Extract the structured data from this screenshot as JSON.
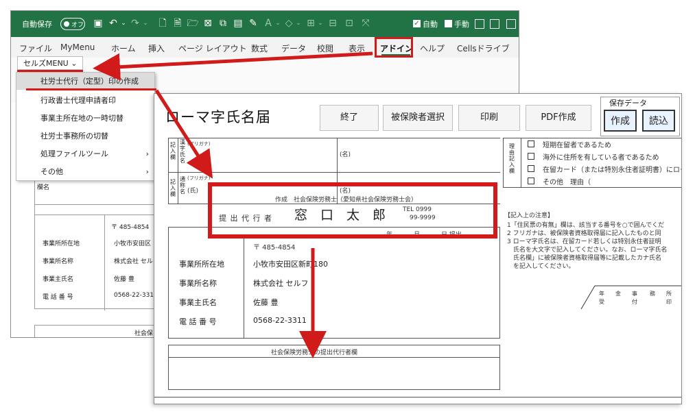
{
  "excel": {
    "titlebar": {
      "autosave_label": "自動保存",
      "autosave_state": "オフ",
      "auto_label": "自動",
      "manual_label": "手動"
    },
    "menu": [
      "ファイル",
      "MyMenu",
      "ホーム",
      "挿入",
      "ページ レイアウト",
      "数式",
      "データ",
      "校閲",
      "表示",
      "アドイン",
      "ヘルプ",
      "Cellsドライブ"
    ],
    "ribbon_button": "セルズMENU",
    "dropdown": [
      {
        "label": "社労士代行（定型）印の作成",
        "submenu": false
      },
      {
        "label": "行政書士代理申請者印",
        "submenu": false
      },
      {
        "label": "事業主所在地の一時切替",
        "submenu": false
      },
      {
        "label": "社労士事務所の切替",
        "submenu": false
      },
      {
        "label": "処理ファイルツール",
        "submenu": true
      },
      {
        "label": "その他",
        "submenu": true
      }
    ],
    "background_sheet": {
      "field_label_short": "欄名",
      "postal": "〒 485-4854",
      "labels": [
        "事業所所在地",
        "事業所名称",
        "事業主氏名",
        "電 話 番 号"
      ],
      "values": [
        "小牧市安田区",
        "株式会社 セル",
        "佐藤 豊",
        "0568-22-331"
      ],
      "footer_partial": "社会保"
    }
  },
  "form": {
    "title": "ローマ字氏名届",
    "buttons": [
      "終了",
      "被保険者選択",
      "印刷",
      "PDF作成"
    ],
    "save_group": {
      "label": "保存データ",
      "buttons": [
        "作成",
        "読込"
      ]
    },
    "name_rows": [
      {
        "side_label": "記入欄",
        "side_label2": "漢字氏名",
        "furigana": "(フリガナ)",
        "mei": "(名)"
      },
      {
        "side_label": "記入欄",
        "side_label2": "通称名",
        "furigana": "(フリガナ)",
        "shi": "(氏)",
        "mei": "(名)"
      }
    ],
    "reason": {
      "side_label": "理由記入欄",
      "options": [
        "短期在留者であるため",
        "海外に住所を有している者であるため",
        "在留カード（または特別永住者証明書）にロー",
        "その他　理由（"
      ]
    },
    "representative": {
      "creator": "作成　社会保険労務士（愛知県社会保険労務士会）",
      "label": "提 出 代 行 者",
      "name": "窓　口　太　郎",
      "tel_label": "TEL 0999",
      "tel_value": "99-9999"
    },
    "date_line": [
      "年",
      "月",
      "日 提出"
    ],
    "employer": {
      "postal": "〒 485-4854",
      "labels": [
        "事業所所在地",
        "事業所名称",
        "事業主氏名",
        "電 話 番 号"
      ],
      "values": [
        "小牧市安田区新町180",
        "株式会社 セルフ",
        "佐藤 豊",
        "0568-22-3311"
      ]
    },
    "bottom_box_title": "社会保険労務士の提出代行者欄",
    "notes": {
      "heading": "【記入上の注意】",
      "lines": [
        "1「住民票の有無」欄は、該当する番号を○で囲んでくだ",
        "2 フリガナは、被保険者資格取得届に記入したものと同",
        "3 ローマ字氏名は、在留カード若しくは特別永住者証明",
        "　氏名を大文字で記入してください。なお、ローマ字氏名",
        "　氏名欄」に被保険者資格取得届等に記載したカナ氏名",
        "　を記入してください。"
      ]
    },
    "office_stamp": {
      "top": [
        "年",
        "金",
        "事",
        "務",
        "所"
      ],
      "bottom": [
        "受",
        "付",
        "印"
      ]
    }
  },
  "colors": {
    "excel_green": "#217346",
    "highlight_red": "#d11a1a"
  }
}
